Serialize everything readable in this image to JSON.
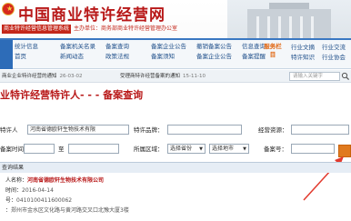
{
  "header": {
    "title": "中国商业特许经营网",
    "subtitle": "商业特许经营信息管理系统",
    "sponsor": "主办单位：商务部商业特许经营管理办公室"
  },
  "nav": {
    "items": [
      "统计信息",
      "备案机关名录",
      "备案查询",
      "备案企业公告",
      "撤销备案公告",
      "信息查询",
      "首页",
      "新闻动态",
      "政策法规",
      "备案须知",
      "备案企业公告",
      "备案提醒"
    ],
    "special": "服务栏目",
    "right_items": [
      "行业文摘",
      "行业交流",
      "特许知识",
      "行业协会"
    ]
  },
  "notice": {
    "items": [
      {
        "text": "商业企业特许经营的通知",
        "date": "26-03-02"
      },
      {
        "text": "受理商特许经营备案的通知",
        "date": "15-11-10"
      }
    ],
    "search_placeholder": "请输入关键字"
  },
  "section": {
    "title": "业特许经营特许人- - - 备案查询"
  },
  "form": {
    "franchisor_label": "特许人",
    "franchisor_value": "河南省德欧轩生物技术有限",
    "brand_label": "特许品牌：",
    "brand_value": "",
    "resource_label": "经营资源：",
    "resource_value": "",
    "date_label": "备案时间：",
    "date_from": "",
    "date_to_label": "至",
    "date_to": "",
    "region_label": "所属区域：",
    "province_option": "选择省份",
    "city_option": "选择地市",
    "record_no_label": "备案号：",
    "record_no_value": ""
  },
  "results": {
    "header": "查询结果",
    "name_label": "人名称：",
    "name_value": "河南省德欧轩生物技术有限公司",
    "date_label": "时间：",
    "date_value": "2016-04-14",
    "record_label": "号：",
    "record_value": "0410100411600062",
    "address_label": "：",
    "address_value": "郑州市金水区文化路与黄河路交叉口北豫大厦3楼"
  },
  "colors": {
    "brand_red": "#b81818",
    "nav_blue": "#2d6cb8",
    "button_orange": "#e07a1e"
  }
}
